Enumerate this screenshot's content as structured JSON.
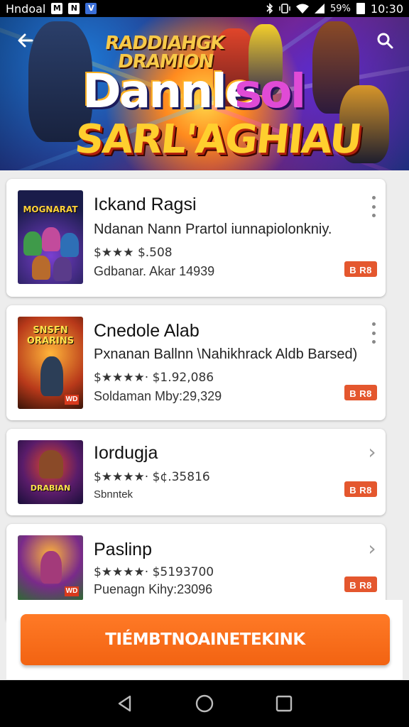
{
  "status_bar": {
    "app_label": "Hndoal",
    "icon1": "M",
    "icon2": "N",
    "icon3": "V",
    "battery_text": "59%",
    "time": "10:30",
    "icons": [
      "bluetooth-icon",
      "vibrate-icon",
      "wifi-icon",
      "signal-icon",
      "battery-icon"
    ]
  },
  "hero": {
    "line1": "RADDIAHGK",
    "line2": "DRAMION",
    "word1": "Dannle",
    "word2": "sol",
    "word3": "SARL'AGHIAU",
    "icons": [
      "back-arrow-icon",
      "search-icon"
    ]
  },
  "items": [
    {
      "title": "Ickand Ragsi",
      "subtitle": "Ndanan Nann Prartol iunnapiolonkniy.",
      "meta": "$★★★ $.508",
      "meta2": "Gdbanar. Akar 14939",
      "thumb_title": "MOGNARAT",
      "thumb_badge": "",
      "tag": "B R8",
      "action": "more-vert-icon"
    },
    {
      "title": "Cnedole Alab",
      "subtitle": "Pxnanan Ballnn \\Nahikhrack Aldb Barsed)",
      "meta": "$★★★★· $1.92,086",
      "meta2": "Soldaman Mby:29,329",
      "thumb_title": "SNSFN ORARINS",
      "thumb_badge": "WD",
      "tag": "B R8",
      "action": "more-vert-icon"
    },
    {
      "title": "Iordugja",
      "subtitle": "",
      "meta": "$★★★★· $¢.35816",
      "meta2": "Sbnntek",
      "thumb_title": "DRABIAN",
      "thumb_badge": "",
      "tag": "B R8",
      "action": "chevron-right-icon"
    },
    {
      "title": "Paslinp",
      "subtitle": "",
      "meta": "$★★★★· $5193700",
      "meta2": "Puenagn Kihy:23096",
      "thumb_title": "",
      "thumb_badge": "WD",
      "tag": "B R8",
      "action": "chevron-right-icon"
    }
  ],
  "cta": {
    "label": "TIÉMBTNOAINETEKINK"
  },
  "nav": {
    "icons": [
      "back-nav-icon",
      "home-nav-icon",
      "recents-nav-icon"
    ]
  },
  "colors": {
    "accent": "#f26312",
    "tag": "#e4572e",
    "background": "#ededed"
  }
}
